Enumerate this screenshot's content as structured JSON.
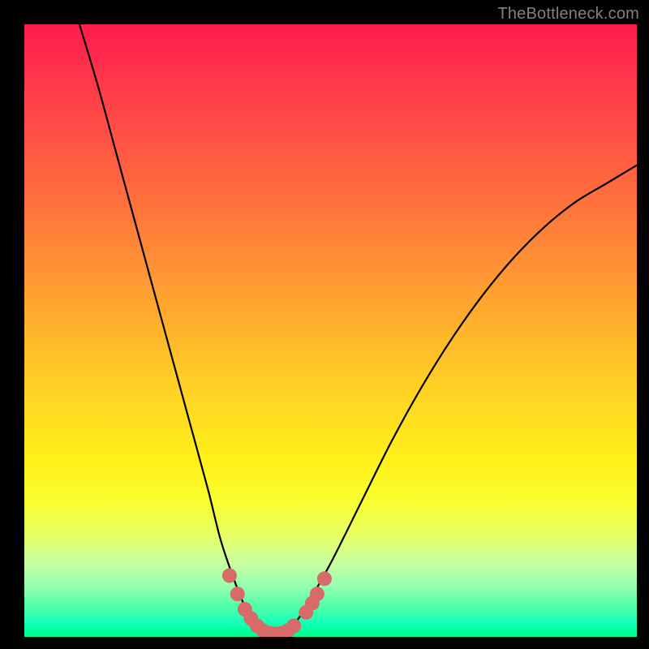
{
  "watermark": "TheBottleneck.com",
  "chart_data": {
    "type": "line",
    "title": "",
    "xlabel": "",
    "ylabel": "",
    "xlim": [
      0,
      100
    ],
    "ylim": [
      0,
      100
    ],
    "gradient_stops": [
      {
        "pos": 0,
        "color": "#ff1a4e"
      },
      {
        "pos": 50,
        "color": "#ffc020"
      },
      {
        "pos": 80,
        "color": "#f0ff40"
      },
      {
        "pos": 100,
        "color": "#00ff88"
      }
    ],
    "series": [
      {
        "name": "bottleneck-curve",
        "color": "#000000",
        "x": [
          9,
          12,
          15,
          18,
          21,
          24,
          27,
          30,
          32,
          34,
          36,
          38,
          40,
          42,
          44,
          46,
          50,
          55,
          60,
          65,
          70,
          75,
          80,
          85,
          90,
          95,
          100
        ],
        "y": [
          100,
          90,
          79,
          68,
          57,
          46,
          35,
          24,
          16,
          10,
          5,
          2,
          0.5,
          0.5,
          2,
          5,
          12,
          22,
          32,
          41,
          49,
          56,
          62,
          67,
          71,
          74,
          77
        ]
      }
    ],
    "markers": {
      "name": "highlighted-points",
      "color": "#d86a6a",
      "points": [
        {
          "x": 33.5,
          "y": 10
        },
        {
          "x": 34.8,
          "y": 7
        },
        {
          "x": 36.0,
          "y": 4.5
        },
        {
          "x": 37.0,
          "y": 3.0
        },
        {
          "x": 38.0,
          "y": 1.8
        },
        {
          "x": 39.0,
          "y": 1.0
        },
        {
          "x": 40.0,
          "y": 0.6
        },
        {
          "x": 41.0,
          "y": 0.5
        },
        {
          "x": 42.0,
          "y": 0.6
        },
        {
          "x": 43.0,
          "y": 1.0
        },
        {
          "x": 44.0,
          "y": 1.8
        },
        {
          "x": 46.0,
          "y": 4.0
        },
        {
          "x": 47.0,
          "y": 5.5
        },
        {
          "x": 47.8,
          "y": 7.0
        },
        {
          "x": 49.0,
          "y": 9.5
        }
      ]
    }
  }
}
